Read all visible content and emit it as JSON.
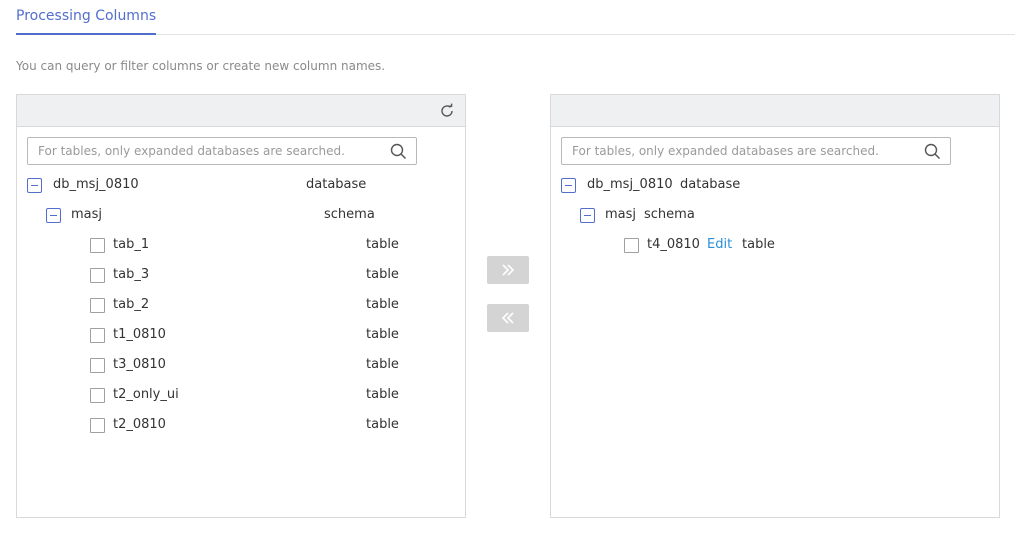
{
  "tabs": {
    "active_label": "Processing Columns"
  },
  "hint_text": "You can query or filter columns or create new column names.",
  "left_panel": {
    "search_placeholder": "For tables, only expanded databases are searched.",
    "database": {
      "name": "db_msj_0810",
      "type": "database"
    },
    "schema": {
      "name": "masj",
      "type": "schema"
    },
    "tables": [
      {
        "name": "tab_1",
        "type": "table"
      },
      {
        "name": "tab_3",
        "type": "table"
      },
      {
        "name": "tab_2",
        "type": "table"
      },
      {
        "name": "t1_0810",
        "type": "table"
      },
      {
        "name": "t3_0810",
        "type": "table"
      },
      {
        "name": "t2_only_ui",
        "type": "table"
      },
      {
        "name": "t2_0810",
        "type": "table"
      }
    ]
  },
  "right_panel": {
    "search_placeholder": "For tables, only expanded databases are searched.",
    "database": {
      "name": "db_msj_0810",
      "type": "database"
    },
    "schema": {
      "name": "masj",
      "type": "schema"
    },
    "tables": [
      {
        "name": "t4_0810",
        "edit_label": "Edit",
        "type": "table"
      }
    ]
  },
  "icons": {
    "refresh": "refresh-icon",
    "search": "search-icon",
    "move_right": "double-chevron-right-icon",
    "move_left": "double-chevron-left-icon"
  },
  "colors": {
    "accent": "#526ecc",
    "link": "#2a8fd8",
    "button_disabled": "#d4d4d4"
  }
}
